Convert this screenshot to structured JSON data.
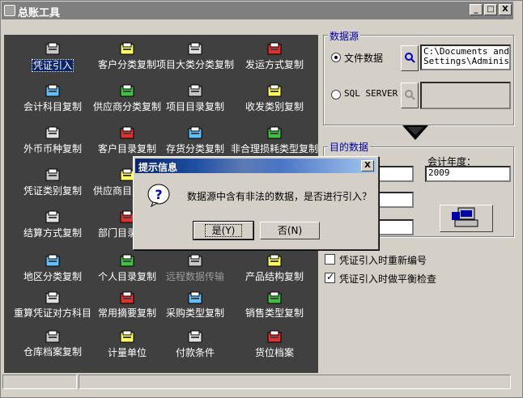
{
  "window": {
    "title": "总账工具",
    "min": "_",
    "max": "□",
    "close": "X"
  },
  "menu": {
    "items": [
      {
        "label": "凭证引入",
        "icon": "voucher-import-icon"
      },
      {
        "label": "客户分类复制",
        "icon": "printer-icon"
      },
      {
        "label": "项目大类分类复制",
        "icon": "item-class-icon"
      },
      {
        "label": "发运方式复制",
        "icon": "transport-icon"
      },
      {
        "label": "会计科目复制",
        "icon": "account-subject-icon"
      },
      {
        "label": "供应商分类复制",
        "icon": "supplier-class-icon"
      },
      {
        "label": "项目目录复制",
        "icon": "item-catalog-icon"
      },
      {
        "label": "收发类别复制",
        "icon": "stock-io-icon"
      },
      {
        "label": "外币币种复制",
        "icon": "currency-icon"
      },
      {
        "label": "客户目录复制",
        "icon": "customer-catalog-icon"
      },
      {
        "label": "存货分类复制",
        "icon": "inventory-class-icon"
      },
      {
        "label": "非合理损耗类型复制",
        "icon": "loss-type-icon"
      },
      {
        "label": "凭证类别复制",
        "icon": "voucher-type-icon"
      },
      {
        "label": "供应商目录复制",
        "icon": "supplier-catalog-icon"
      },
      {
        "label": "结算方式复制",
        "icon": "settlement-icon"
      },
      {
        "label": "部门目录复制",
        "icon": "department-icon"
      },
      {
        "label": "地区分类复制",
        "icon": "region-icon"
      },
      {
        "label": "个人目录复制",
        "icon": "person-icon"
      },
      {
        "label": "远程数据传输",
        "icon": "remote-transfer-icon"
      },
      {
        "label": "产品结构复制",
        "icon": "product-structure-icon"
      },
      {
        "label": "重算凭证对方科目",
        "icon": "recalc-icon"
      },
      {
        "label": "常用摘要复制",
        "icon": "summary-icon"
      },
      {
        "label": "采购类型复制",
        "icon": "purchase-type-icon"
      },
      {
        "label": "销售类型复制",
        "icon": "sales-type-icon"
      },
      {
        "label": "仓库档案复制",
        "icon": "warehouse-icon"
      },
      {
        "label": "计量单位",
        "icon": "unit-icon"
      },
      {
        "label": "付款条件",
        "icon": "payment-icon"
      },
      {
        "label": "货位档案",
        "icon": "location-icon"
      }
    ]
  },
  "source": {
    "group_label": "数据源",
    "file_option": "文件数据",
    "file_path": "C:\\Documents and\nSettings\\Administ",
    "sql_option": "SQL SERVER",
    "sql_value": ""
  },
  "target": {
    "group_label": "目的数据",
    "year_label": "会计年度：",
    "year_value": "2009"
  },
  "options": {
    "renumber": "凭证引入时重新编号",
    "balance_check": "凭证引入时做平衡检查"
  },
  "dialog": {
    "title": "提示信息",
    "close": "X",
    "message": "数据源中含有非法的数据，是否进行引入？",
    "yes": "是(Y)",
    "no": "否(N)"
  }
}
